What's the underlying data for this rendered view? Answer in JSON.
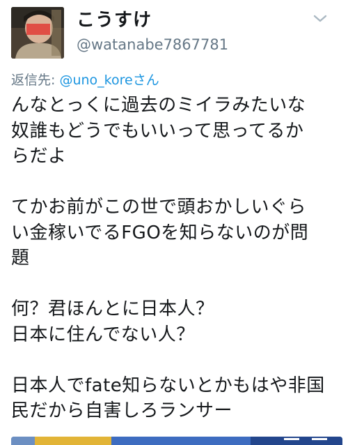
{
  "author": {
    "display_name": "こうすけ",
    "handle": "@watanabe7867781"
  },
  "icons": {
    "avatar": "profile-photo",
    "menu": "chevron-down-icon"
  },
  "reply": {
    "prefix": "返信先: ",
    "mention": "@uno_koreさん"
  },
  "tweet": {
    "paragraphs": [
      [
        "んなとっくに過去のミイラみたいな",
        "奴誰もどうでもいいって思ってるか",
        "らだよ"
      ],
      [
        "てかお前がこの世で頭おかしいぐら",
        "い金稼いでるFGOを知らないのが問",
        "題"
      ],
      [
        "何？君ほんとに日本人？",
        "日本に住んでない人？"
      ],
      [
        "日本人でfate知らないとかもはや非国",
        "民だから自害しろランサー"
      ]
    ]
  },
  "colors": {
    "text": "#14171a",
    "secondary": "#657786",
    "link": "#1b95e0"
  }
}
